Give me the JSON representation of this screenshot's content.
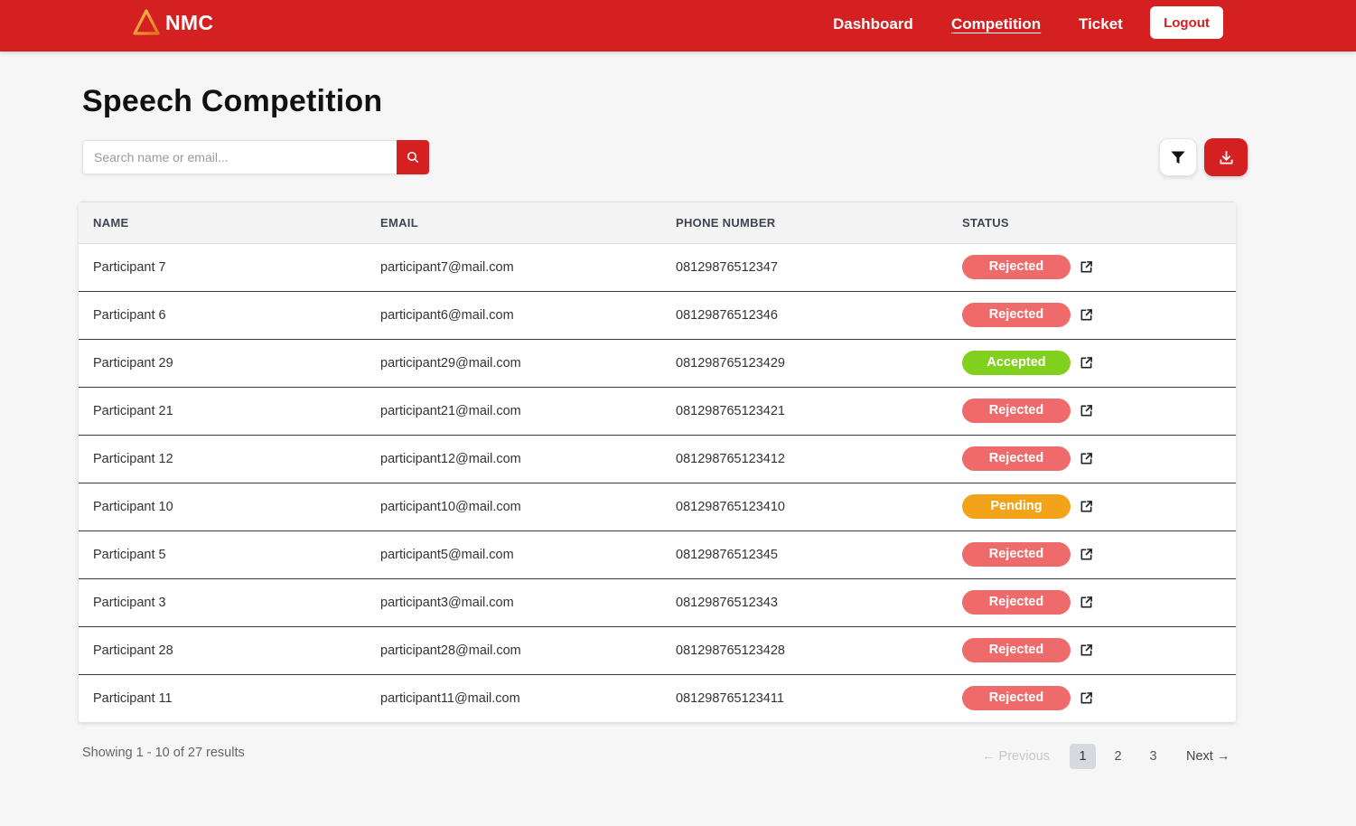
{
  "nav": {
    "brand": "NMC",
    "links": [
      {
        "label": "Dashboard",
        "active": false
      },
      {
        "label": "Competition",
        "active": true
      },
      {
        "label": "Ticket",
        "active": false
      }
    ],
    "logout_label": "Logout"
  },
  "page": {
    "title": "Speech Competition"
  },
  "search": {
    "placeholder": "Search name or email...",
    "value": ""
  },
  "table": {
    "headers": [
      "NAME",
      "EMAIL",
      "PHONE NUMBER",
      "STATUS"
    ],
    "rows": [
      {
        "name": "Participant 7",
        "email": "participant7@mail.com",
        "phone": "08129876512347",
        "status": "Rejected"
      },
      {
        "name": "Participant 6",
        "email": "participant6@mail.com",
        "phone": "08129876512346",
        "status": "Rejected"
      },
      {
        "name": "Participant 29",
        "email": "participant29@mail.com",
        "phone": "081298765123429",
        "status": "Accepted"
      },
      {
        "name": "Participant 21",
        "email": "participant21@mail.com",
        "phone": "081298765123421",
        "status": "Rejected"
      },
      {
        "name": "Participant 12",
        "email": "participant12@mail.com",
        "phone": "081298765123412",
        "status": "Rejected"
      },
      {
        "name": "Participant 10",
        "email": "participant10@mail.com",
        "phone": "081298765123410",
        "status": "Pending"
      },
      {
        "name": "Participant 5",
        "email": "participant5@mail.com",
        "phone": "08129876512345",
        "status": "Rejected"
      },
      {
        "name": "Participant 3",
        "email": "participant3@mail.com",
        "phone": "08129876512343",
        "status": "Rejected"
      },
      {
        "name": "Participant 28",
        "email": "participant28@mail.com",
        "phone": "081298765123428",
        "status": "Rejected"
      },
      {
        "name": "Participant 11",
        "email": "participant11@mail.com",
        "phone": "081298765123411",
        "status": "Rejected"
      }
    ]
  },
  "footer": {
    "results_text": "Showing 1 - 10 of 27 results",
    "prev_label": "← Previous",
    "next_label": "Next →",
    "pages": [
      "1",
      "2",
      "3"
    ],
    "current_page": "1"
  },
  "colors": {
    "brand_red": "#d42020",
    "rejected": "#ef6a6a",
    "accepted": "#82d01e",
    "pending": "#f2a31a"
  },
  "icons": {
    "logo": "triangle-logo-icon",
    "search": "search-icon",
    "filter": "filter-icon",
    "download": "download-icon",
    "row_action": "external-link-icon"
  }
}
